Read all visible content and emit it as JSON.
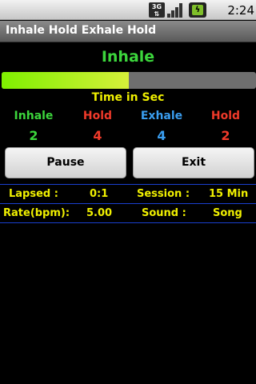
{
  "status_bar": {
    "network_label": "3G",
    "time": "2:24 PM",
    "icons": [
      "3g-data-icon",
      "signal-icon",
      "battery-charging-icon"
    ]
  },
  "app": {
    "title": "Inhale Hold Exhale Hold"
  },
  "current_phase": {
    "label": "Inhale",
    "color": "#3cd63c"
  },
  "progress": {
    "fraction": 0.5
  },
  "time_heading": "Time in Sec",
  "phases": [
    {
      "label": "Inhale",
      "value": "2",
      "color": "#3cd63c"
    },
    {
      "label": "Hold",
      "value": "4",
      "color": "#f03a2a"
    },
    {
      "label": "Exhale",
      "value": "4",
      "color": "#3a9ef0"
    },
    {
      "label": "Hold",
      "value": "2",
      "color": "#f03a2a"
    }
  ],
  "buttons": {
    "pause": "Pause",
    "exit": "Exit"
  },
  "stats": {
    "lapsed_label": "Lapsed :",
    "lapsed_value": "0:1",
    "session_label": "Session :",
    "session_value": "15 Min",
    "rate_label": "Rate(bpm):",
    "rate_value": "5.00",
    "sound_label": "Sound :",
    "sound_value": "Song"
  },
  "colors": {
    "accent_yellow": "#f0f000",
    "divider_blue": "#1a3fd0"
  }
}
